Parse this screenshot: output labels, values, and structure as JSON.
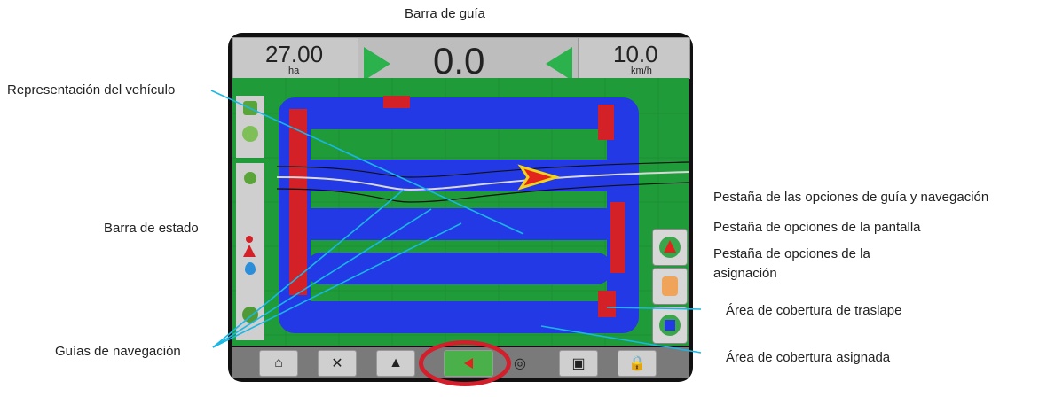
{
  "labels": {
    "guidance_bar": "Barra de guía",
    "vehicle": "Representación del vehículo",
    "status_bar": "Barra de estado",
    "nav_guides": "Guías de navegación",
    "guide_nav_tab": "Pestaña de las opciones de guía y navegación",
    "screen_tab": "Pestaña de opciones de la pantalla",
    "mapping_tab_line1": "Pestaña de opciones de la",
    "mapping_tab_line2": "asignación",
    "overlap_area": "Área de cobertura de traslape",
    "applied_area": "Área de cobertura asignada"
  },
  "display": {
    "area_value": "27.00",
    "area_unit": "ha",
    "offline_value": "0.0",
    "speed_value": "10.0",
    "speed_unit": "km/h"
  },
  "colors": {
    "field": "#1f9b3a",
    "coverage": "#2439e6",
    "overlap": "#d42027",
    "leader": "#19b7e6",
    "highlight_circle": "#d21f2b"
  },
  "bottom_nav": [
    "home-icon",
    "tools-icon",
    "field-icon",
    "guidance-icon",
    "camera-icon",
    "chat-icon",
    "lock-icon"
  ]
}
